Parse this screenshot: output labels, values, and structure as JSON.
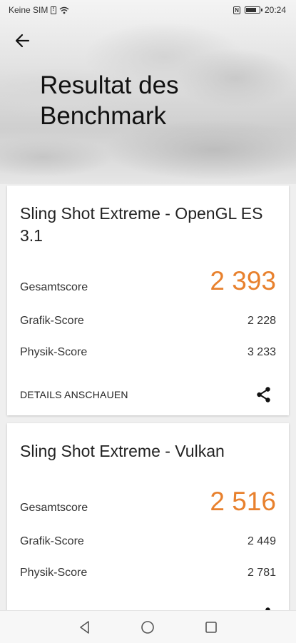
{
  "status_bar": {
    "carrier": "Keine SIM",
    "time": "20:24",
    "icons": [
      "sim-warning-icon",
      "wifi-icon",
      "nfc-icon",
      "battery-icon"
    ]
  },
  "header": {
    "title": "Resultat des Benchmark",
    "back_icon": "arrow-left-icon"
  },
  "results": [
    {
      "title": "Sling Shot Extreme - OpenGL ES 3.1",
      "total_label": "Gesamtscore",
      "total_value": "2 393",
      "graphics_label": "Grafik-Score",
      "graphics_value": "2 228",
      "physics_label": "Physik-Score",
      "physics_value": "3 233",
      "details_label": "DETAILS ANSCHAUEN",
      "share_icon": "share-icon"
    },
    {
      "title": "Sling Shot Extreme - Vulkan",
      "total_label": "Gesamtscore",
      "total_value": "2 516",
      "graphics_label": "Grafik-Score",
      "graphics_value": "2 449",
      "physics_label": "Physik-Score",
      "physics_value": "2 781"
    }
  ],
  "colors": {
    "accent": "#e8812e",
    "text": "#222222",
    "background": "#efefef"
  },
  "nav_bar": {
    "icons": [
      "back-triangle-icon",
      "home-circle-icon",
      "recents-square-icon"
    ]
  }
}
